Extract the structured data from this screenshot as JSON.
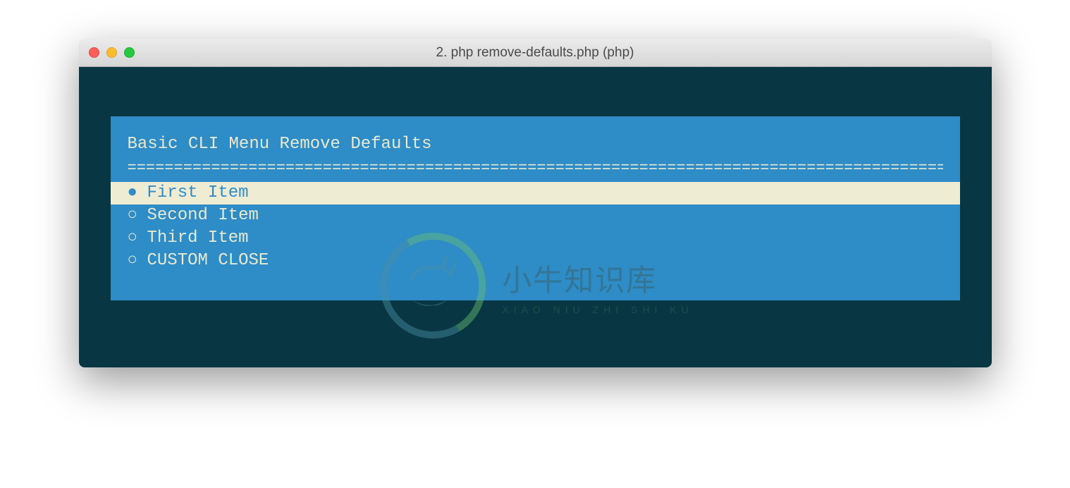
{
  "window": {
    "title": "2. php remove-defaults.php (php)"
  },
  "menu": {
    "title": "Basic CLI Menu Remove Defaults",
    "divider": "========================================================================================",
    "items": [
      {
        "label": "First Item",
        "selected": true,
        "marker": "●"
      },
      {
        "label": "Second Item",
        "selected": false,
        "marker": "○"
      },
      {
        "label": "Third Item",
        "selected": false,
        "marker": "○"
      },
      {
        "label": "CUSTOM CLOSE",
        "selected": false,
        "marker": "○"
      }
    ]
  },
  "watermark": {
    "cn": "小牛知识库",
    "en": "XIAO NIU ZHI SHI KU"
  },
  "colors": {
    "terminal_bg": "#083642",
    "menu_bg": "#2e8cc7",
    "text": "#e8e9d0",
    "selected_bg": "#efecd4",
    "selected_text": "#2e8cc7"
  }
}
